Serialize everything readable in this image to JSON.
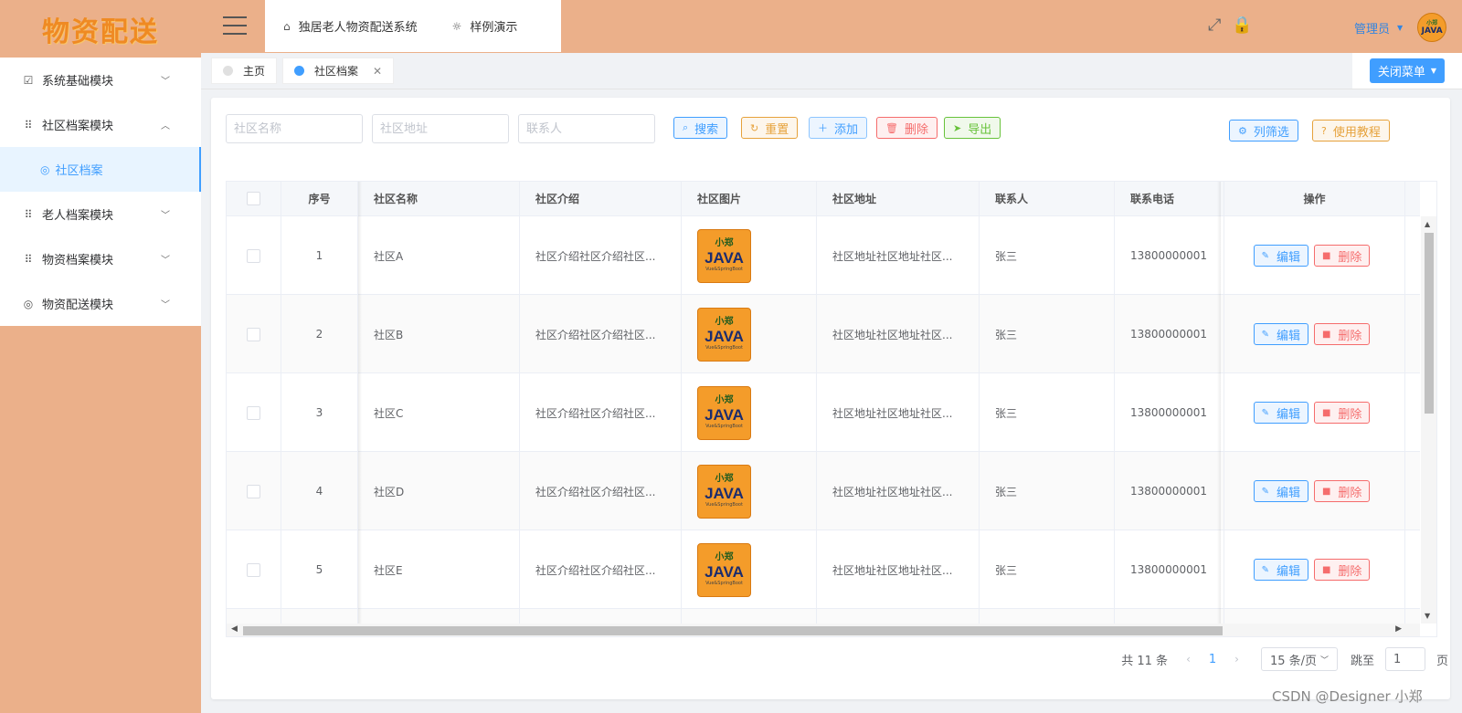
{
  "brand": {
    "logo_text": "物资配送"
  },
  "sidebar": {
    "items": [
      {
        "label": "系统基础模块",
        "icon": "chart-check-icon",
        "expanded": false
      },
      {
        "label": "社区档案模块",
        "icon": "grid-icon",
        "expanded": true
      },
      {
        "label": "老人档案模块",
        "icon": "grid-icon",
        "expanded": false
      },
      {
        "label": "物资档案模块",
        "icon": "grid-icon",
        "expanded": false
      },
      {
        "label": "物资配送模块",
        "icon": "circle-icon",
        "expanded": false
      }
    ],
    "sub_item": {
      "label": "社区档案",
      "icon": "circle-icon"
    }
  },
  "header": {
    "crumbs": [
      {
        "label": "独居老人物资配送系统",
        "icon": "home-icon"
      },
      {
        "label": "样例演示",
        "icon": "bulb-icon"
      }
    ],
    "user_name": "管理员",
    "avatar_text": "JAVA",
    "avatar_subtext": "小郑"
  },
  "tabs": [
    {
      "label": "主页",
      "active": false
    },
    {
      "label": "社区档案",
      "active": true
    }
  ],
  "close_menu_label": "关闭菜单",
  "search": {
    "name_placeholder": "社区名称",
    "address_placeholder": "社区地址",
    "contact_placeholder": "联系人"
  },
  "toolbar": {
    "search": "搜索",
    "reset": "重置",
    "add": "添加",
    "delete": "删除",
    "export": "导出",
    "column_filter": "列筛选",
    "tutorial": "使用教程"
  },
  "table": {
    "columns": [
      "序号",
      "社区名称",
      "社区介绍",
      "社区图片",
      "社区地址",
      "联系人",
      "联系电话",
      "操作"
    ],
    "image_text": {
      "top": "小郑",
      "main": "JAVA",
      "bottom": "Vue&SpringBoot"
    },
    "edit_label": "编辑",
    "delete_label": "删除",
    "rows": [
      {
        "index": "1",
        "name": "社区A",
        "intro": "社区介绍社区介绍社区...",
        "address": "社区地址社区地址社区...",
        "contact": "张三",
        "phone": "13800000001"
      },
      {
        "index": "2",
        "name": "社区B",
        "intro": "社区介绍社区介绍社区...",
        "address": "社区地址社区地址社区...",
        "contact": "张三",
        "phone": "13800000001"
      },
      {
        "index": "3",
        "name": "社区C",
        "intro": "社区介绍社区介绍社区...",
        "address": "社区地址社区地址社区...",
        "contact": "张三",
        "phone": "13800000001"
      },
      {
        "index": "4",
        "name": "社区D",
        "intro": "社区介绍社区介绍社区...",
        "address": "社区地址社区地址社区...",
        "contact": "张三",
        "phone": "13800000001"
      },
      {
        "index": "5",
        "name": "社区E",
        "intro": "社区介绍社区介绍社区...",
        "address": "社区地址社区地址社区...",
        "contact": "张三",
        "phone": "13800000001"
      }
    ]
  },
  "pagination": {
    "total_text": "共 11 条",
    "current_page": "1",
    "page_size": "15 条/页",
    "jump_label": "跳至",
    "jump_value": "1",
    "page_suffix": "页"
  },
  "watermark": "CSDN @Designer 小郑",
  "colors": {
    "accent": "#409eff",
    "brand_bg": "#ebb08a",
    "danger": "#f56c6c",
    "warning": "#e6a23c",
    "success": "#67c23a"
  }
}
